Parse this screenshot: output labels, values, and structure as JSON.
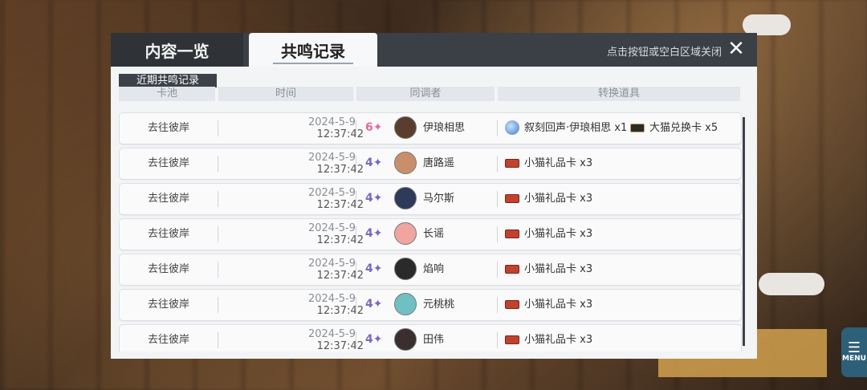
{
  "tabs": {
    "overview": "内容一览",
    "history": "共鸣记录"
  },
  "close_hint": "点击按钮或空白区域关闭",
  "section_label": "近期共鸣记录",
  "columns": {
    "pool": "卡池",
    "time": "时间",
    "resonator": "同调者",
    "items": "转换道具"
  },
  "rows": [
    {
      "pool": "去往彼岸",
      "date": "2024-5-9",
      "time": "12:37:42",
      "rarity": "6",
      "name": "伊琅相思",
      "item1": "叙刻回声·伊琅相思 x1",
      "item2": "大猫兑换卡 x5"
    },
    {
      "pool": "去往彼岸",
      "date": "2024-5-9",
      "time": "12:37:42",
      "rarity": "4",
      "name": "唐路遥",
      "item1": "小猫礼品卡 x3",
      "item2": ""
    },
    {
      "pool": "去往彼岸",
      "date": "2024-5-9",
      "time": "12:37:42",
      "rarity": "4",
      "name": "马尔斯",
      "item1": "小猫礼品卡 x3",
      "item2": ""
    },
    {
      "pool": "去往彼岸",
      "date": "2024-5-9",
      "time": "12:37:42",
      "rarity": "4",
      "name": "长谣",
      "item1": "小猫礼品卡 x3",
      "item2": ""
    },
    {
      "pool": "去往彼岸",
      "date": "2024-5-9",
      "time": "12:37:42",
      "rarity": "4",
      "name": "焰响",
      "item1": "小猫礼品卡 x3",
      "item2": ""
    },
    {
      "pool": "去往彼岸",
      "date": "2024-5-9",
      "time": "12:37:42",
      "rarity": "4",
      "name": "元桃桃",
      "item1": "小猫礼品卡 x3",
      "item2": ""
    },
    {
      "pool": "去往彼岸",
      "date": "2024-5-9",
      "time": "12:37:42",
      "rarity": "4",
      "name": "田伟",
      "item1": "小猫礼品卡 x3",
      "item2": ""
    }
  ],
  "menu": {
    "label": "MENU"
  },
  "colors": {
    "rarity6": "#e26aa0",
    "rarity4": "#7b65c6",
    "active_tab_bg": "#f7f8fa",
    "tabbar_bg": "#3b4046"
  },
  "icons": {
    "close": "close-icon",
    "star": "star-icon",
    "ticket": "ticket-icon",
    "echo": "echo-icon",
    "menu": "menu-icon"
  }
}
